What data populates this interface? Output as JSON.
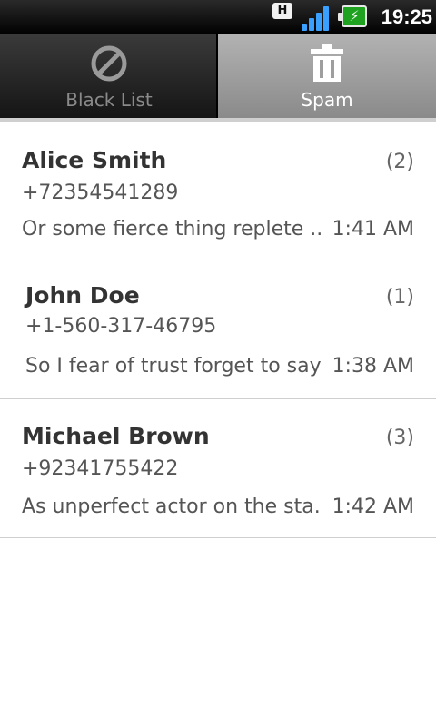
{
  "status_bar": {
    "network_type": "H",
    "time": "19:25",
    "icons": [
      "network-type-icon",
      "signal-strength-icon",
      "battery-charging-icon"
    ]
  },
  "tabs": [
    {
      "label": "Black List",
      "icon": "block-icon",
      "selected": false
    },
    {
      "label": "Spam",
      "icon": "trash-icon",
      "selected": true
    }
  ],
  "colors": {
    "signal": "#3aa0ff",
    "battery": "#1fa21f",
    "selected_tab": "#9e9e9e",
    "unselected_tab": "#222222"
  },
  "messages": [
    {
      "name": "Alice Smith",
      "count": "(2)",
      "number": "+72354541289",
      "preview": "Or some fierce thing replete ...",
      "time": "1:41 AM"
    },
    {
      "name": "John Doe",
      "count": "(1)",
      "number": "+1-560-317-46795",
      "preview": "So I fear of trust forget to say",
      "time": "1:38 AM"
    },
    {
      "name": "Michael Brown",
      "count": "(3)",
      "number": "+92341755422",
      "preview": "As unperfect actor on the sta...",
      "time": "1:42 AM"
    }
  ]
}
